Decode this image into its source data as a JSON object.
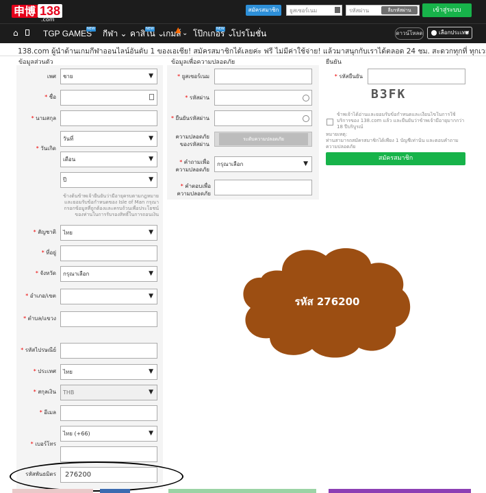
{
  "header": {
    "logo_chinese": "申博",
    "logo_number": "138",
    "logo_domain": ".com",
    "register_button": "สมัครสมาชิก",
    "username_placeholder": "ยูสเซอร์เนม",
    "password_placeholder": "รหัสผ่าน",
    "forgot_button": "ลืมรหัสผ่าน",
    "login_button": "เข้าสู่ระบบ"
  },
  "nav": {
    "items": [
      {
        "label": "TGP GAMES",
        "badge": "NEW"
      },
      {
        "label": "กีฬา"
      },
      {
        "label": "คาสิโน",
        "badge": "NEW"
      },
      {
        "label": "เกมส์"
      },
      {
        "label": "โป๊กเกอร์",
        "badge": "NEW"
      },
      {
        "label": "โปรโมชั่น"
      }
    ],
    "download_pill": "ดาวน์โหลด",
    "language_select": "เลือกประเทศ"
  },
  "promo_text": "138.com ผู้นำด้านเกมกีฬาออนไลน์อันดับ 1 ของเอเชีย! สมัครสมาชิกได้เลยค่ะ ฟรี ไม่มีค่าใช้จ่าย! แล้วมาสนุกกับเราได้ตลอด 24 ชม. สะดวกทุกที่ ทุกเวลา!",
  "personal": {
    "title": "ข้อมูลส่วนตัว",
    "gender_label": "เพศ",
    "gender_value": "ชาย",
    "first_name_label": "ชื่อ",
    "last_name_label": "นามสกุล",
    "dob_label": "วันเกิด",
    "day_value": "วันที่",
    "month_value": "เดือน",
    "year_value": "ปี",
    "dob_note": "ข้างต้นข้าพเจ้ายืนยันว่ามีอายุครบตามกฎหมายและยอมรับข้อกำหนดของ Isle of Man กรุณากรอกข้อมูลที่ถูกต้องและครบถ้วนเพื่อประโยชน์ของท่านในการรับรองสิทธิ์ในการถอนเงิน",
    "nationality_label": "สัญชาติ",
    "nationality_value": "ไทย",
    "address_label": "ที่อยู่",
    "province_label": "จังหวัด",
    "province_value": "กรุณาเลือก",
    "district_label": "อำเภอ/เขต",
    "subdistrict_label": "ตำบล/แขวง",
    "postcode_label": "รหัสไปรษณีย์",
    "country_label": "ประเทศ",
    "country_value": "ไทย",
    "currency_label": "สกุลเงิน",
    "currency_value": "THB",
    "email_label": "อีเมล",
    "phone_label": "เบอร์โทร",
    "phone_code_value": "ไทย (+66)",
    "partner_code_label": "รหัสพันธมิตร",
    "partner_code_value": "276200"
  },
  "security": {
    "title": "ข้อมูลเพื่อความปลอดภัย",
    "username_label": "ยูสเซอร์เนม",
    "password_label": "รหัสผ่าน",
    "confirm_password_label": "ยืนยันรหัสผ่าน",
    "strength_label": "ความปลอดภัยของรหัสผ่าน",
    "strength_value": "ระดับความปลอดภัย",
    "question_label": "คำถามเพื่อความปลอดภัย",
    "question_value": "กรุณาเลือก",
    "answer_label": "คำตอบเพื่อความปลอดภัย"
  },
  "confirm": {
    "title": "ยืนยัน",
    "captcha_label": "รหัสยืนยัน",
    "captcha_text": "B3FK",
    "terms_text": "ข้าพเจ้าได้อ่านและยอมรับข้อกำหนดและเงื่อนไขในการใช้บริการของ 138.com แล้ว และยืนยันว่าข้าพเจ้ามีอายุมากกว่า 18 ปีบริบูรณ์",
    "notice_title": "หมายเหตุ:",
    "notice_text": "ท่านสามารถสมัครสมาชิกได้เพียง 1 บัญชีเท่านั้น และตอบคำถามความปลอดภัย",
    "submit_button": "สมัครสมาชิก"
  },
  "cloud": {
    "text": "รหัส 276200",
    "fill": "#9c4e12"
  },
  "colors": {
    "header_bg": "#1c1c1c",
    "accent_blue": "#2d8fd8",
    "accent_green": "#17b34a",
    "brand_red": "#e6001a"
  }
}
